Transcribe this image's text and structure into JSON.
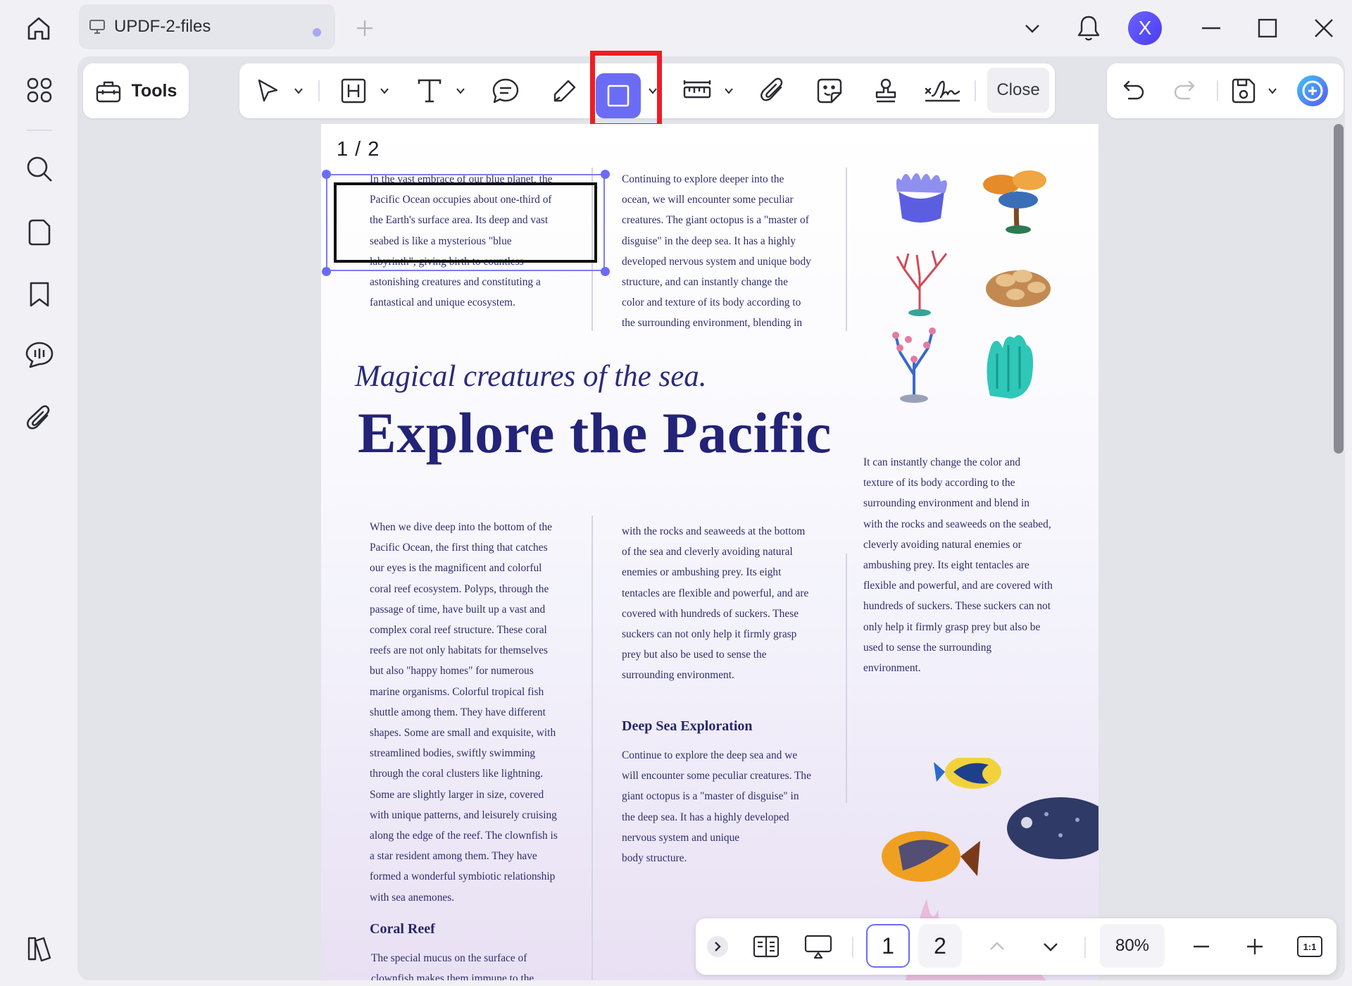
{
  "titlebar": {
    "tab_title": "UPDF-2-files",
    "avatar_letter": "X"
  },
  "toolbar": {
    "tools_label": "Tools",
    "close_label": "Close",
    "active_tool": "rectangle-tool",
    "accent_color": "#6b6cf5",
    "highlight_color": "#ef1c24"
  },
  "document": {
    "page_indicator": "1 / 2",
    "col1_top": [
      "In the vast embrace of our blue planet, the",
      "Pacific Ocean occupies about one-third of",
      "the Earth's surface area. Its deep and vast",
      "seabed is like a mysterious \"blue",
      "labyrinth\", giving birth to countless",
      "astonishing creatures and constituting a",
      "fantastical and unique ecosystem."
    ],
    "col2_top": [
      "Continuing to explore deeper into the",
      "ocean, we will encounter some peculiar",
      "creatures. The giant octopus is a \"master of",
      "disguise\" in the deep sea. It has a highly",
      "developed nervous system and unique body",
      "structure, and can instantly change the",
      "color and texture of its body according to",
      "the surrounding environment, blending in"
    ],
    "subtitle": "Magical creatures of the sea.",
    "title": "Explore the Pacific",
    "col3_mid": [
      "It can instantly change the color and",
      "texture of its body according to the",
      "surrounding environment and blend in",
      "with the rocks and seaweeds on the seabed,",
      "cleverly avoiding natural enemies or",
      "ambushing prey. Its eight tentacles are",
      "flexible and powerful, and are covered with",
      "hundreds of suckers. These suckers can not",
      "only help it firmly grasp prey but also be",
      "used to sense the surrounding",
      "environment."
    ],
    "col1_bottom": [
      "When we dive deep into the bottom of the",
      "Pacific Ocean, the first thing that catches",
      "our eyes is the magnificent and colorful",
      "coral reef ecosystem. Polyps, through the",
      "passage of time, have built up a vast and",
      "complex coral reef structure. These coral",
      "reefs are not only habitats for themselves",
      "but also \"happy homes\" for numerous",
      "marine organisms. Colorful tropical fish",
      "shuttle among them. They have different",
      "shapes. Some are small and exquisite, with",
      "streamlined bodies, swiftly swimming",
      "through the coral clusters like lightning.",
      "Some are slightly larger in size, covered",
      "with unique patterns, and leisurely cruising",
      "along the edge of the reef. The clownfish is",
      "a star resident among them. They have",
      "formed a wonderful symbiotic relationship",
      "with sea anemones."
    ],
    "col2_bottom": [
      "with the rocks and seaweeds at the bottom",
      "of the sea and cleverly avoiding natural",
      "enemies or ambushing prey. Its eight",
      "tentacles are flexible and powerful, and are",
      "covered with hundreds of suckers. These",
      "suckers can not only help it firmly grasp",
      "prey but also be used to sense the",
      "surrounding environment."
    ],
    "deep_sea_heading": "Deep Sea Exploration",
    "deep_sea_text": [
      "Continue to explore the deep sea and we",
      "will encounter some peculiar creatures. The",
      "giant octopus is a \"master of disguise\" in",
      "the deep sea. It has a highly developed",
      "nervous system and unique",
      "body structure."
    ],
    "coral_reef_heading": "Coral Reef",
    "coral_reef_text": [
      "The special mucus on the surface of",
      "clownfish makes them immune to the"
    ]
  },
  "bottombar": {
    "page_1": "1",
    "page_2": "2",
    "zoom": "80%",
    "fit_label": "1:1"
  }
}
